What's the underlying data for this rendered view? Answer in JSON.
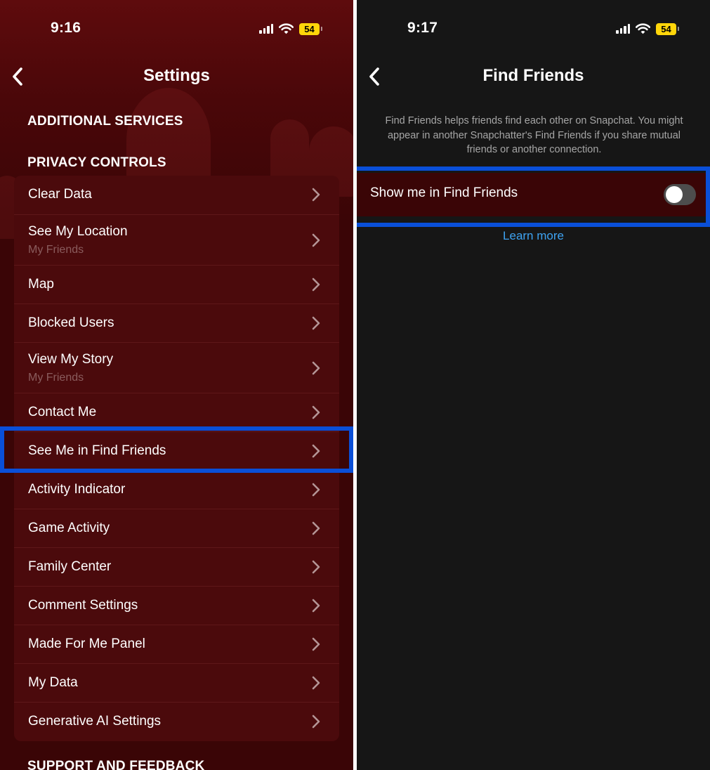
{
  "left": {
    "status": {
      "time": "9:16",
      "battery": "54"
    },
    "nav": {
      "title": "Settings"
    },
    "sections": {
      "additional_services": "ADDITIONAL SERVICES",
      "privacy_controls": "PRIVACY CONTROLS",
      "support_feedback": "SUPPORT AND FEEDBACK"
    },
    "privacy_items": [
      {
        "label": "Clear Data",
        "sub": ""
      },
      {
        "label": "See My Location",
        "sub": "My Friends"
      },
      {
        "label": "Map",
        "sub": ""
      },
      {
        "label": "Blocked Users",
        "sub": ""
      },
      {
        "label": "View My Story",
        "sub": "My Friends"
      },
      {
        "label": "Contact Me",
        "sub": ""
      },
      {
        "label": "See Me in Find Friends",
        "sub": ""
      },
      {
        "label": "Activity Indicator",
        "sub": ""
      },
      {
        "label": "Game Activity",
        "sub": ""
      },
      {
        "label": "Family Center",
        "sub": ""
      },
      {
        "label": "Comment Settings",
        "sub": ""
      },
      {
        "label": "Made For Me Panel",
        "sub": ""
      },
      {
        "label": "My Data",
        "sub": ""
      },
      {
        "label": "Generative AI Settings",
        "sub": ""
      }
    ],
    "highlighted_item": "See Me in Find Friends"
  },
  "right": {
    "status": {
      "time": "9:17",
      "battery": "54"
    },
    "nav": {
      "title": "Find Friends"
    },
    "description": "Find Friends helps friends find each other on Snapchat. You might appear in another Snapchatter's Find Friends if you share mutual friends or another connection.",
    "toggle": {
      "label": "Show me in Find Friends",
      "state": "off"
    },
    "learn_more": "Learn more"
  },
  "colors": {
    "highlight": "#0a4fd8",
    "link": "#3ea3f2",
    "battery": "#ffd60a",
    "card": "#4b0a0c",
    "dark_bg": "#161616"
  },
  "icons": [
    "back-chevron-icon",
    "chevron-right-icon",
    "cellular-signal-icon",
    "wifi-icon",
    "battery-icon"
  ]
}
